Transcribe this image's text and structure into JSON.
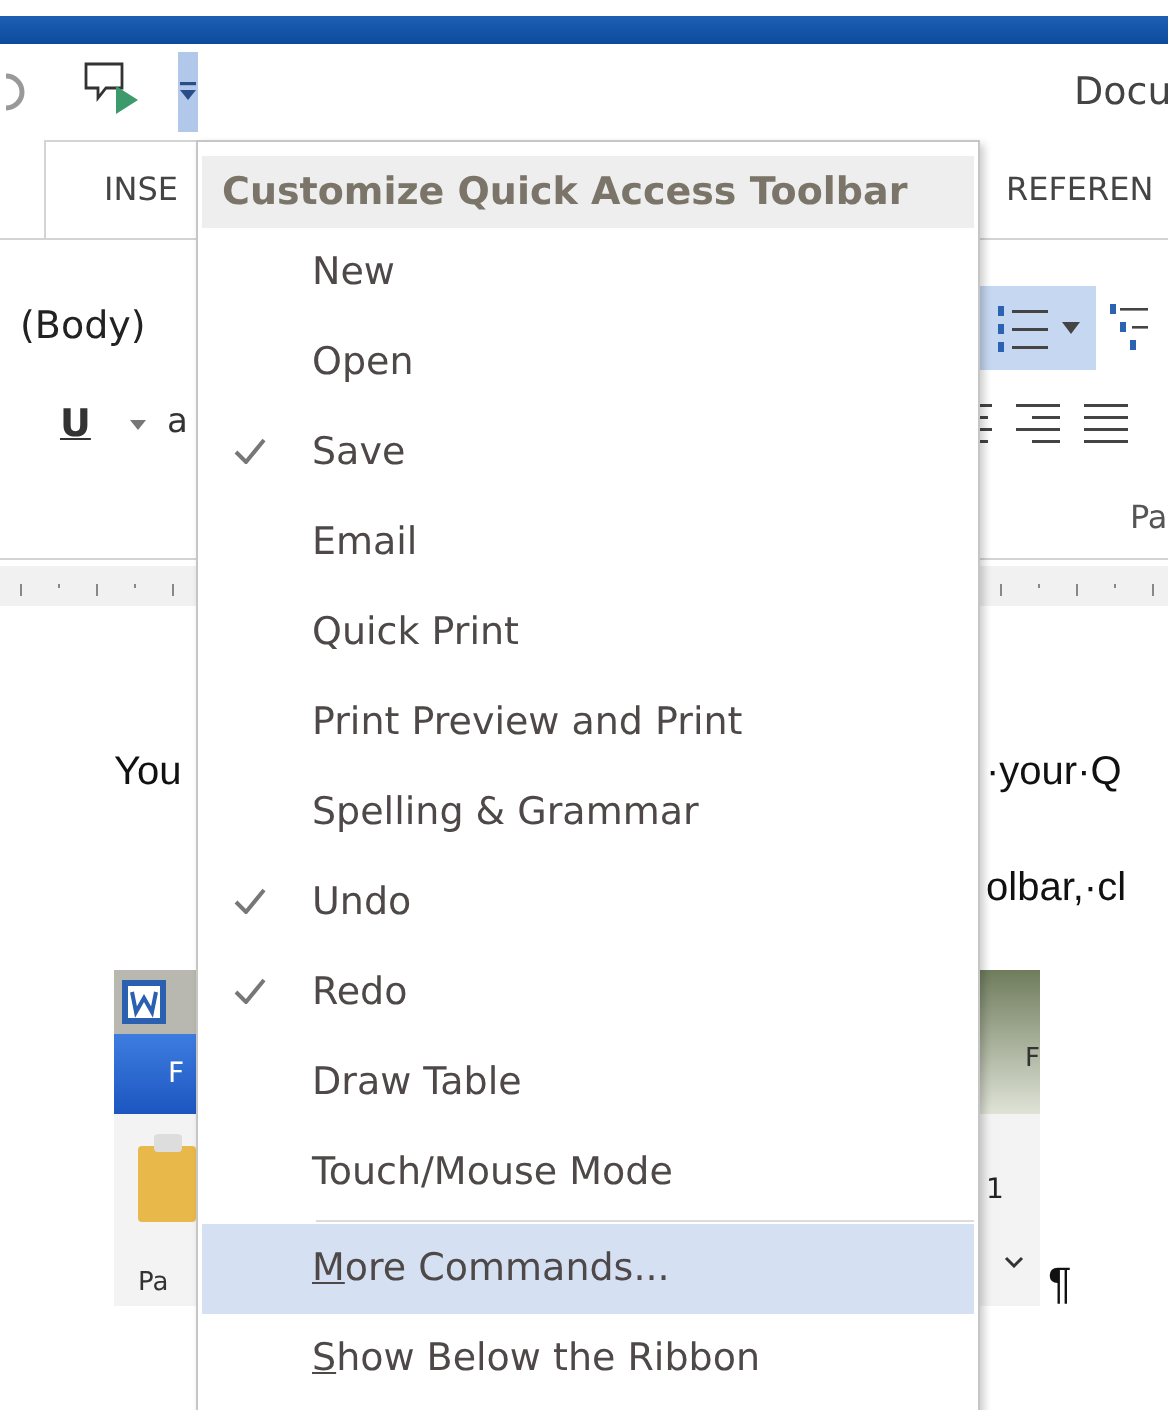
{
  "title_bar": {
    "document_title": "Docu"
  },
  "quick_access": {
    "customize_button": {
      "expanded": true
    }
  },
  "ribbon_tabs": [
    {
      "label": "INSE",
      "selected": true
    },
    {
      "label": "REFEREN",
      "selected": false
    }
  ],
  "ribbon": {
    "font_name": "(Body)",
    "underline_label": "U",
    "font_color_label": "a",
    "group_label": "Pa"
  },
  "document": {
    "line_1": {
      "left": "You",
      "right": "·your·Q"
    },
    "line_2": {
      "right": "olbar,·cl"
    },
    "pilcrow": "¶"
  },
  "embedded_screenshot": {
    "left_tab": "F",
    "left_label": "Pa",
    "right_tab": "F",
    "right_value": "1"
  },
  "menu": {
    "title": "Customize Quick Access Toolbar",
    "items": [
      {
        "label": "New",
        "kind": "toggle",
        "checked": false,
        "selected": false
      },
      {
        "label": "Open",
        "kind": "toggle",
        "checked": false,
        "selected": false
      },
      {
        "label": "Save",
        "kind": "toggle",
        "checked": true,
        "selected": false
      },
      {
        "label": "Email",
        "kind": "toggle",
        "checked": false,
        "selected": false
      },
      {
        "label": "Quick Print",
        "kind": "toggle",
        "checked": false,
        "selected": false
      },
      {
        "label": "Print Preview and Print",
        "kind": "toggle",
        "checked": false,
        "selected": false
      },
      {
        "label": "Spelling & Grammar",
        "kind": "toggle",
        "checked": false,
        "selected": false
      },
      {
        "label": "Undo",
        "kind": "toggle",
        "checked": true,
        "selected": false
      },
      {
        "label": "Redo",
        "kind": "toggle",
        "checked": true,
        "selected": false
      },
      {
        "label": "Draw Table",
        "kind": "toggle",
        "checked": false,
        "selected": false
      },
      {
        "label": "Touch/Mouse Mode",
        "kind": "toggle",
        "checked": false,
        "selected": false
      },
      {
        "label": "More Commands...",
        "kind": "command",
        "mnemonic": true,
        "selected": true
      },
      {
        "label": "Show Below the Ribbon",
        "kind": "command",
        "mnemonic": true,
        "selected": false
      }
    ]
  }
}
